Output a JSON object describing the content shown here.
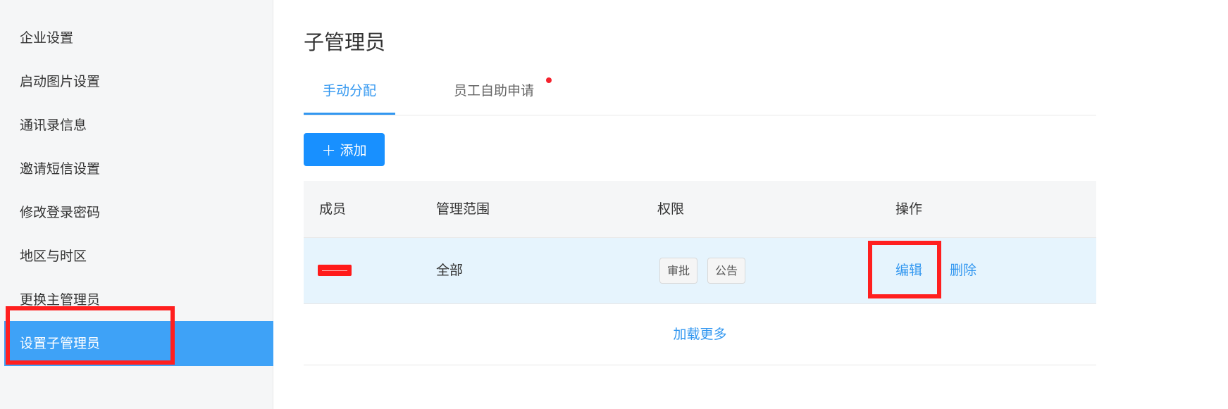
{
  "sidebar": {
    "items": [
      {
        "label": "企业设置"
      },
      {
        "label": "启动图片设置"
      },
      {
        "label": "通讯录信息"
      },
      {
        "label": "邀请短信设置"
      },
      {
        "label": "修改登录密码"
      },
      {
        "label": "地区与时区"
      },
      {
        "label": "更换主管理员"
      },
      {
        "label": "设置子管理员"
      }
    ]
  },
  "main": {
    "title": "子管理员",
    "tabs": [
      {
        "label": "手动分配"
      },
      {
        "label": "员工自助申请"
      }
    ],
    "add_button": {
      "icon": "plus-icon",
      "label": "添加"
    },
    "table": {
      "headers": [
        "成员",
        "管理范围",
        "权限",
        "操作"
      ],
      "rows": [
        {
          "scope": "全部",
          "permissions": [
            "审批",
            "公告"
          ],
          "actions": [
            "编辑",
            "删除"
          ]
        }
      ],
      "load_more": "加载更多"
    }
  },
  "colors": {
    "accent": "#1890ff",
    "sidebar_active": "#3ea2f7",
    "row_highlight": "#e6f4fd",
    "notification_dot": "#f5222d",
    "annotation": "#ff1f1f"
  }
}
